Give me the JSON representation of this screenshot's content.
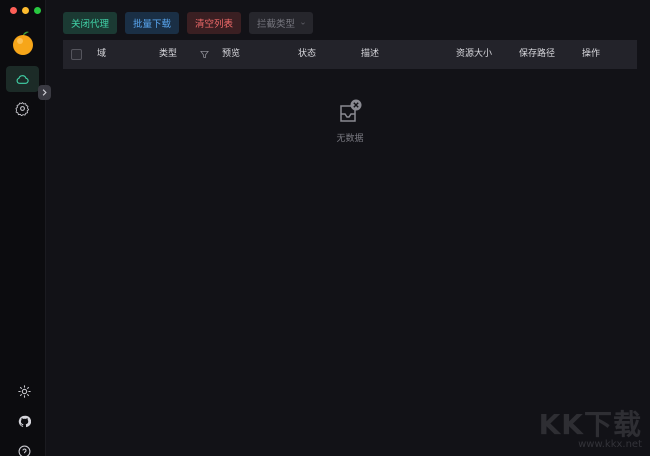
{
  "toolbar": {
    "close_proxy": "关闭代理",
    "batch_download": "批量下载",
    "clear_list": "清空列表",
    "intercept_type": "拦截类型"
  },
  "table": {
    "columns": [
      "域",
      "类型",
      "预览",
      "状态",
      "描述",
      "资源大小",
      "保存路径",
      "操作"
    ]
  },
  "empty": {
    "text": "无数据"
  },
  "watermark": {
    "logo": "KK下载",
    "url": "www.kkx.net"
  },
  "colors": {
    "accent_green": "#41d3a8",
    "accent_blue": "#5aa8f2",
    "accent_red": "#f06a6a",
    "background": "#121217"
  }
}
